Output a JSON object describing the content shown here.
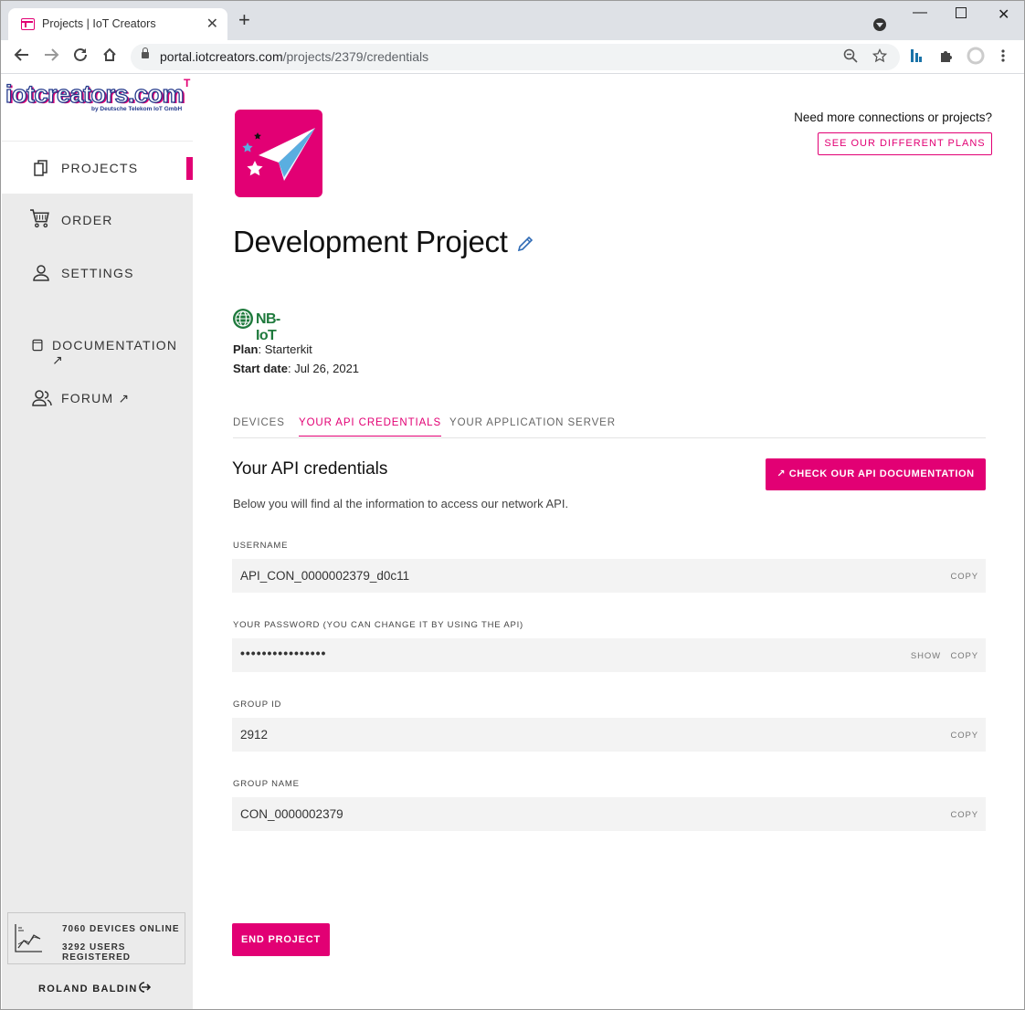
{
  "browser": {
    "tab_title": "Projects | IoT Creators",
    "tab_close": "✕",
    "new_tab": "+",
    "url_host": "portal.iotcreators.com",
    "url_path": "/projects/2379/credentials"
  },
  "sidebar": {
    "logo": "iotcreators.com",
    "logo_sub": "by Deutsche Telekom IoT GmbH",
    "logo_mark": "T",
    "items": [
      {
        "label": "PROJECTS",
        "icon": "documents-icon"
      },
      {
        "label": "ORDER",
        "icon": "cart-icon"
      },
      {
        "label": "SETTINGS",
        "icon": "user-icon"
      },
      {
        "label": "DOCUMENTATION ↗",
        "icon": "book-icon"
      },
      {
        "label": "FORUM ↗",
        "icon": "users-icon"
      }
    ],
    "stats": {
      "devices": "7060 DEVICES ONLINE",
      "users": "3292 USERS REGISTERED"
    },
    "user_name": "ROLAND BALDIN"
  },
  "main": {
    "upsell_text": "Need more connections or projects?",
    "plans_button": "SEE OUR DIFFERENT PLANS",
    "project_title": "Development Project",
    "network_badge": "NB-IoT",
    "plan_label": "Plan",
    "plan_value": ": Starterkit",
    "start_label": "Start date",
    "start_value": ": Jul 26, 2021",
    "tabs": [
      "DEVICES",
      "YOUR API CREDENTIALS",
      "YOUR APPLICATION SERVER"
    ],
    "section_title": "Your API credentials",
    "section_desc": "Below you will find al the information to access our network API.",
    "api_button": "↗  CHECK OUR API DOCUMENTATION",
    "fields": [
      {
        "label": "USERNAME",
        "value": "API_CON_0000002379_d0c11",
        "copy": "COPY"
      },
      {
        "label": "YOUR PASSWORD (YOU CAN CHANGE IT BY USING THE API)",
        "value": "••••••••••••••••",
        "show": "SHOW",
        "copy": "COPY"
      },
      {
        "label": "GROUP ID",
        "value": "2912",
        "copy": "COPY"
      },
      {
        "label": "GROUP NAME",
        "value": "CON_0000002379",
        "copy": "COPY"
      }
    ],
    "end_button": "END PROJECT"
  },
  "colors": {
    "brand": "#e20074",
    "sidebar_bg": "#ebebeb",
    "field_bg": "#f3f3f3"
  }
}
